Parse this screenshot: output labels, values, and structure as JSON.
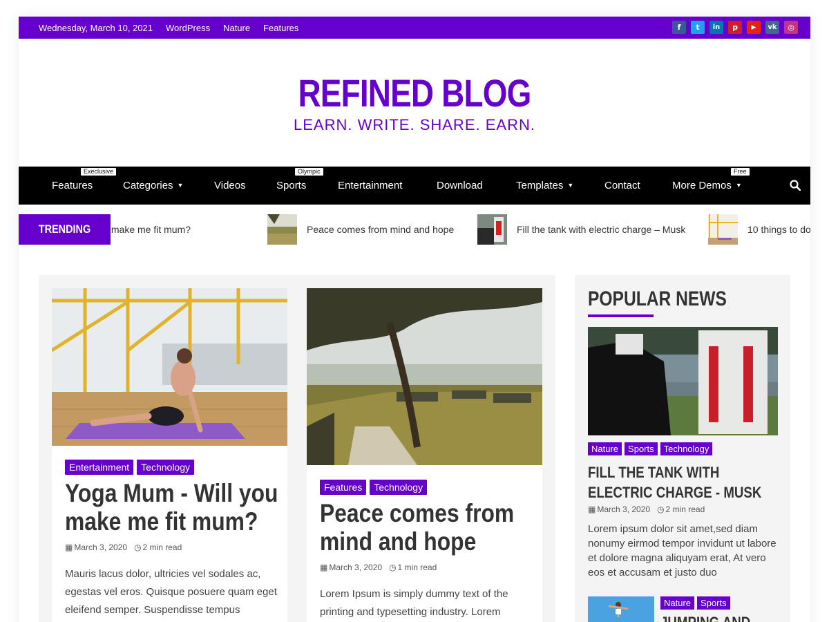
{
  "topbar": {
    "date": "Wednesday, March 10, 2021",
    "links": [
      "WordPress",
      "Nature",
      "Features"
    ],
    "social": [
      {
        "icon": "facebook-icon",
        "glyph": "f",
        "color": "#3b5998"
      },
      {
        "icon": "twitter-icon",
        "glyph": "t",
        "color": "#1da1f2"
      },
      {
        "icon": "linkedin-icon",
        "glyph": "in",
        "color": "#0077b5"
      },
      {
        "icon": "pinterest-icon",
        "glyph": "p",
        "color": "#cb2027"
      },
      {
        "icon": "youtube-icon",
        "glyph": "▶",
        "color": "#e62117"
      },
      {
        "icon": "vk-icon",
        "glyph": "vk",
        "color": "#45668e"
      },
      {
        "icon": "instagram-icon",
        "glyph": "◎",
        "color": "#c13584"
      }
    ]
  },
  "header": {
    "title": "REFINED BLOG",
    "tagline": "LEARN. WRITE. SHARE. EARN."
  },
  "nav": {
    "items": [
      {
        "label": "Features",
        "badge": "Execlusive",
        "dropdown": false
      },
      {
        "label": "Categories",
        "badge": "",
        "dropdown": true
      },
      {
        "label": "Videos",
        "badge": "",
        "dropdown": false
      },
      {
        "label": "Sports",
        "badge": "Olympic",
        "dropdown": false
      },
      {
        "label": "Entertainment",
        "badge": "",
        "dropdown": false
      },
      {
        "label": "Download",
        "badge": "",
        "dropdown": false
      },
      {
        "label": "Templates",
        "badge": "",
        "dropdown": true
      },
      {
        "label": "Contact",
        "badge": "",
        "dropdown": false
      },
      {
        "label": "More Demos",
        "badge": "Free",
        "dropdown": true
      }
    ]
  },
  "trending": {
    "label": "TRENDING NEWS",
    "items": [
      "Yoga Mum – Will you make me fit mum?",
      "Peace comes from mind and hope",
      "Fill the tank with electric charge – Musk",
      "10 things to do"
    ]
  },
  "posts": [
    {
      "categories": [
        "Entertainment",
        "Technology"
      ],
      "title": "Yoga Mum - Will you make me fit mum?",
      "date": "March 3, 2020",
      "read_time": "2 min read",
      "excerpt": "Mauris lacus dolor, ultricies vel sodales ac, egestas vel eros. Quisque posuere quam eget eleifend semper. Suspendisse tempus"
    },
    {
      "categories": [
        "Features",
        "Technology"
      ],
      "title": "Peace comes from mind and hope",
      "date": "March 3, 2020",
      "read_time": "1 min read",
      "excerpt": "Lorem Ipsum is simply dummy text of the printing and typesetting industry. Lorem"
    }
  ],
  "sidebar": {
    "title": "POPULAR NEWS",
    "featured": {
      "categories": [
        "Nature",
        "Sports",
        "Technology"
      ],
      "title": "FILL THE TANK WITH ELECTRIC CHARGE - MUSK",
      "date": "March 3, 2020",
      "read_time": "2 min read",
      "excerpt": "Lorem ipsum dolor sit amet,sed diam nonumy eirmod tempor invidunt ut labore et dolore magna aliquyam erat, At vero eos et accusam et justo duo"
    },
    "second": {
      "categories": [
        "Nature",
        "Sports"
      ],
      "title": "JUMPING AND"
    }
  },
  "colors": {
    "accent": "#6600cc",
    "nav_bg": "#000000",
    "panel_bg": "#f4f4f4"
  }
}
